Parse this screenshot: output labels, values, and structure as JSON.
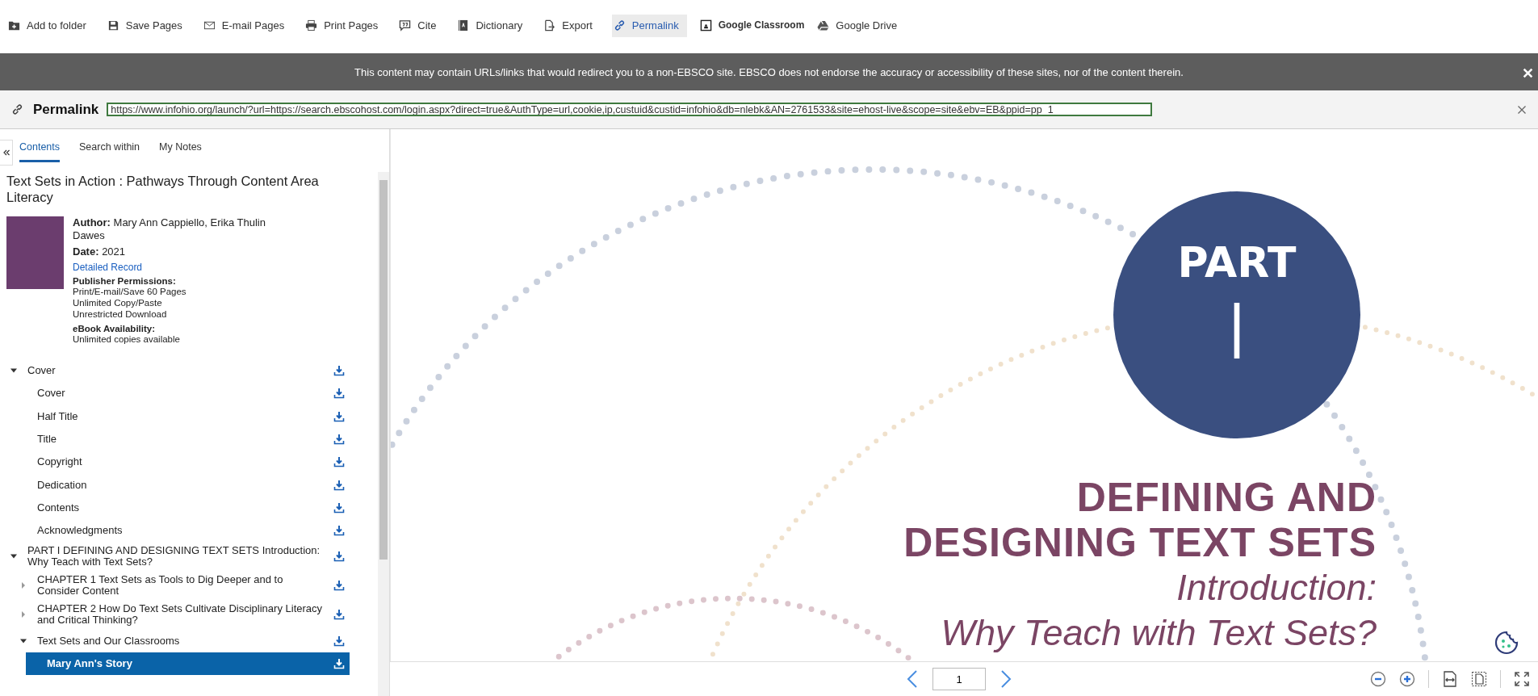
{
  "toolbar": [
    {
      "kind": "folder",
      "label": "Add to folder",
      "selected": false,
      "bold": false
    },
    {
      "kind": "save",
      "label": "Save Pages",
      "selected": false,
      "bold": false
    },
    {
      "kind": "mail",
      "label": "E-mail Pages",
      "selected": false,
      "bold": false
    },
    {
      "kind": "print",
      "label": "Print Pages",
      "selected": false,
      "bold": false
    },
    {
      "kind": "cite",
      "label": "Cite",
      "selected": false,
      "bold": false
    },
    {
      "kind": "dictionary",
      "label": "Dictionary",
      "selected": false,
      "bold": false
    },
    {
      "kind": "export",
      "label": "Export",
      "selected": false,
      "bold": false
    },
    {
      "kind": "link",
      "label": "Permalink",
      "selected": true,
      "bold": false
    },
    {
      "kind": "classroom",
      "label": "Google Classroom",
      "selected": false,
      "bold": true
    },
    {
      "kind": "drive",
      "label": "Google Drive",
      "selected": false,
      "bold": false
    }
  ],
  "notice": {
    "text": "This content may contain URLs/links that would redirect you to a non-EBSCO site. EBSCO does not endorse the accuracy or accessibility of these sites, nor of the content therein."
  },
  "permalink": {
    "label": "Permalink",
    "value": "https://www.infohio.org/launch/?url=https://search.ebscohost.com/login.aspx?direct=true&AuthType=url,cookie,ip,custuid&custid=infohio&db=nlebk&AN=2761533&site=ehost-live&scope=site&ebv=EB&ppid=pp_1"
  },
  "sidebar": {
    "tabs": [
      {
        "label": "Contents",
        "selected": true
      },
      {
        "label": "Search within",
        "selected": false
      },
      {
        "label": "My Notes",
        "selected": false
      }
    ],
    "book": {
      "title": "Text Sets in Action : Pathways Through Content Area Literacy",
      "author": "**Author:** Mary Ann Cappiello, Erika Thulin Dawes",
      "date": "**Date:** 2021",
      "record_link": "Detailed Record",
      "permissions_label": "Publisher Permissions:",
      "permissions": [
        "Print/E-mail/Save 60 Pages",
        "Unlimited Copy/Paste",
        "Unrestricted Download"
      ],
      "availability_label": "eBook Availability:",
      "availability": "Unlimited copies available"
    },
    "contents": [
      {
        "label": "Cover",
        "expanded": true,
        "selected": false,
        "children": [
          {
            "label": "Cover",
            "selected": false
          },
          {
            "label": "Half Title",
            "selected": false
          },
          {
            "label": "Title",
            "selected": false
          },
          {
            "label": "Copyright",
            "selected": false
          },
          {
            "label": "Dedication",
            "selected": false
          },
          {
            "label": "Contents",
            "selected": false
          },
          {
            "label": "Acknowledgments",
            "selected": false
          }
        ]
      },
      {
        "label": "PART I DEFINING AND DESIGNING TEXT SETS Introduction: Why Teach with Text Sets?",
        "expanded": true,
        "selected": false,
        "children": [
          {
            "label": "CHAPTER 1 Text Sets as Tools to Dig Deeper and to Consider Content",
            "expanded": false,
            "selected": false
          },
          {
            "label": "CHAPTER 2 How Do Text Sets Cultivate Disciplinary Literacy and Critical Thinking?",
            "expanded": false,
            "selected": false
          },
          {
            "label": "Text Sets and Our Classrooms",
            "expanded": true,
            "selected": false,
            "children": [
              {
                "label": "Mary Ann's Story",
                "selected": true
              }
            ]
          }
        ]
      }
    ]
  },
  "page": {
    "part_label": "PART",
    "part_number": "I",
    "title_lines": [
      "DEFINING AND",
      "DESIGNING TEXT SETS"
    ],
    "subtitle_lines": [
      "Introduction:",
      "Why Teach with Text Sets?"
    ]
  },
  "pager": {
    "page": "1"
  }
}
